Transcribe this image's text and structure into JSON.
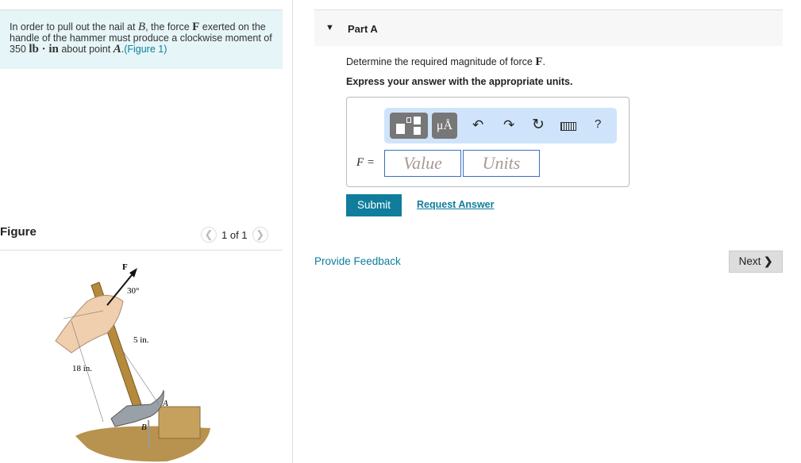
{
  "problem": {
    "t1": "In order to pull out the nail at ",
    "B": "B",
    "t2": ", the force ",
    "F": "F",
    "t3": " exerted on the handle of the hammer must produce a clockwise moment of 350 ",
    "unit": "lb · in",
    "t4": " about point ",
    "A": "A",
    "t5": ".",
    "figure_link": "(Figure 1)"
  },
  "figure": {
    "title": "Figure",
    "pager": "1 of 1",
    "prev_icon": "chevron-left-icon",
    "next_icon": "chevron-right-icon",
    "labels": {
      "F": "F",
      "angle": "30°",
      "d5": "5 in.",
      "d18": "18 in.",
      "A": "A",
      "B": "B"
    }
  },
  "part": {
    "title": "Part A",
    "q1": "Determine the required magnitude of force ",
    "q1F": "F",
    "q1end": ".",
    "q2": "Express your answer with the appropriate units."
  },
  "answer": {
    "label": "F =",
    "value_placeholder": "Value",
    "units_placeholder": "Units",
    "mu": "μÅ",
    "help": "?"
  },
  "buttons": {
    "submit": "Submit",
    "request": "Request Answer",
    "feedback": "Provide Feedback",
    "next": "Next"
  },
  "colors": {
    "accent": "#0f7d9b",
    "problem_bg": "#e6f5f7",
    "toolbar_bg": "#cfe4fb"
  }
}
